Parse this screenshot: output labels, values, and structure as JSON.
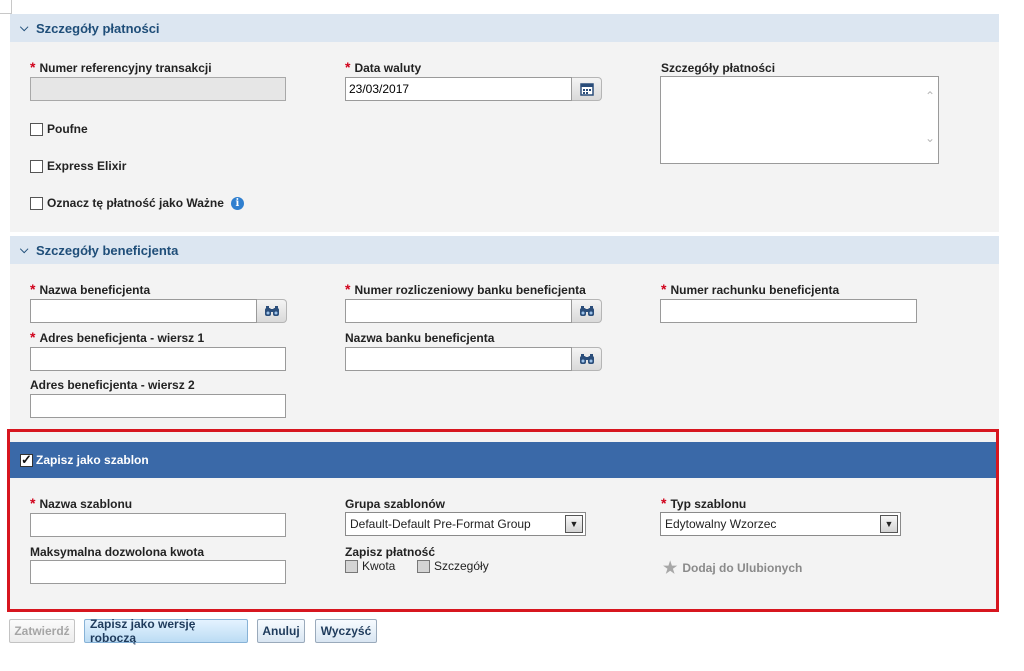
{
  "payment_section": {
    "title": "Szczegóły płatności",
    "ref_label": "Numer referencyjny transakcji",
    "ref_value": "",
    "date_label": "Data waluty",
    "date_value": "23/03/2017",
    "details_label": "Szczegóły płatności",
    "details_value": "",
    "confidential_label": "Poufne",
    "express_label": "Express Elixir",
    "important_label": "Oznacz tę płatność jako Ważne"
  },
  "beneficiary_section": {
    "title": "Szczegóły beneficjenta",
    "name_label": "Nazwa beneficjenta",
    "name_value": "",
    "bank_code_label": "Numer rozliczeniowy banku beneficjenta",
    "bank_code_value": "",
    "account_label": "Numer rachunku beneficjenta",
    "account_value": "",
    "address1_label": "Adres beneficjenta - wiersz 1",
    "address1_value": "",
    "bank_name_label": "Nazwa banku beneficjenta",
    "bank_name_value": "",
    "address2_label": "Adres beneficjenta - wiersz 2",
    "address2_value": ""
  },
  "template_section": {
    "save_as_template_label": "Zapisz jako szablon",
    "save_as_template_checked": true,
    "template_name_label": "Nazwa szablonu",
    "template_name_value": "",
    "template_group_label": "Grupa szablonów",
    "template_group_value": "Default-Default Pre-Format Group",
    "template_type_label": "Typ szablonu",
    "template_type_value": "Edytowalny Wzorzec",
    "max_amount_label": "Maksymalna dozwolona kwota",
    "max_amount_value": "",
    "save_payment_label": "Zapisz płatność",
    "amount_label": "Kwota",
    "details_label": "Szczegóły",
    "favorites_label": "Dodaj do Ulubionych"
  },
  "buttons": {
    "confirm": "Zatwierdź",
    "save_draft": "Zapisz jako wersję roboczą",
    "cancel": "Anuluj",
    "clear": "Wyczyść"
  },
  "icons": {
    "section_toggle": "chevron-down-icon",
    "calendar": "calendar-icon",
    "lookup": "binoculars-icon",
    "info": "info-icon",
    "favorite": "star-icon"
  },
  "colors": {
    "section_header_bg": "#dce6f1",
    "template_bar_bg": "#3a69a8",
    "highlight_border": "#d7161f",
    "required_star": "#d0021b"
  }
}
